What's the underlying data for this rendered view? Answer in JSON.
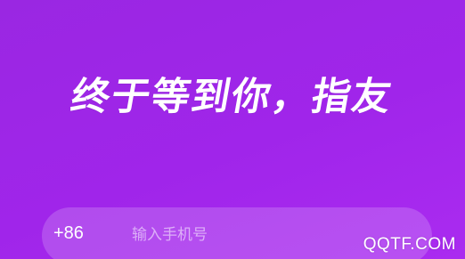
{
  "headline": "终于等到你，指友",
  "phone": {
    "country_code": "+86",
    "placeholder": "输入手机号",
    "value": ""
  },
  "watermark": "QQTF.COM",
  "colors": {
    "background_start": "#9a27e2",
    "background_end": "#aa2bf0",
    "text": "#ffffff"
  }
}
